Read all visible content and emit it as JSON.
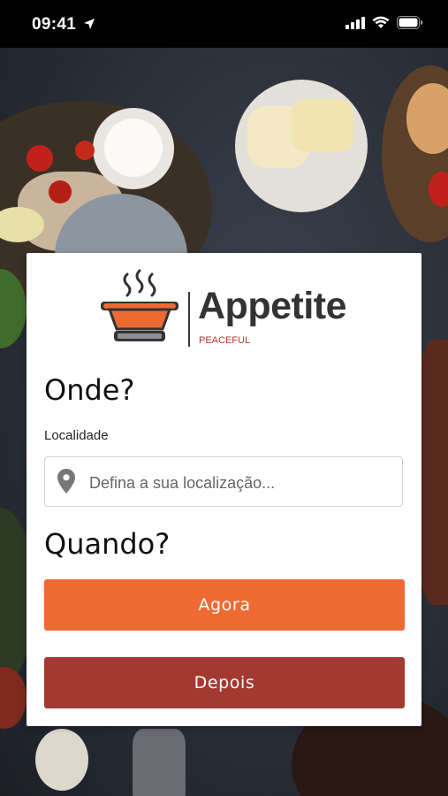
{
  "status_bar": {
    "time": "09:41"
  },
  "brand": {
    "name": "Appetite",
    "tagline": "PEACEFUL"
  },
  "where": {
    "heading": "Onde?",
    "location_label": "Localidade",
    "location_placeholder": "Defina a sua localização...",
    "location_value": ""
  },
  "when": {
    "heading": "Quando?",
    "now_label": "Agora",
    "later_label": "Depois"
  },
  "colors": {
    "accent_orange": "#ee6a33",
    "accent_red": "#a33a32",
    "logo_pot": "#ee6a33"
  }
}
